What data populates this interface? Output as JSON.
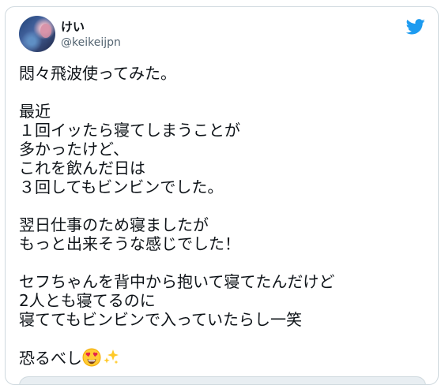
{
  "user": {
    "display_name": "けい",
    "handle": "@keikeijpn"
  },
  "tweet": {
    "body": "悶々飛波使ってみた。\n\n最近\n１回イッたら寝てしまうことが\n多かったけど、\nこれを飲んだ日は\n３回してもビンビンでした。\n\n翌日仕事のため寝ましたが\nもっと出来そうな感じでした！\n\nセフちゃんを背中から抱いて寝てたんだけど\n2人とも寝てるのに\n寝ててもビンビンで入っていたらし一笑\n\n",
    "last_line": "恐るべし"
  },
  "icons": {
    "brand": "twitter-bird-icon",
    "emoji_1": "heart-eyes-emoji",
    "emoji_2": "sparkles-emoji"
  },
  "colors": {
    "twitter_blue": "#1d9bf0",
    "text": "#0f1419",
    "secondary_text": "#536471",
    "border": "#cfd9de"
  }
}
